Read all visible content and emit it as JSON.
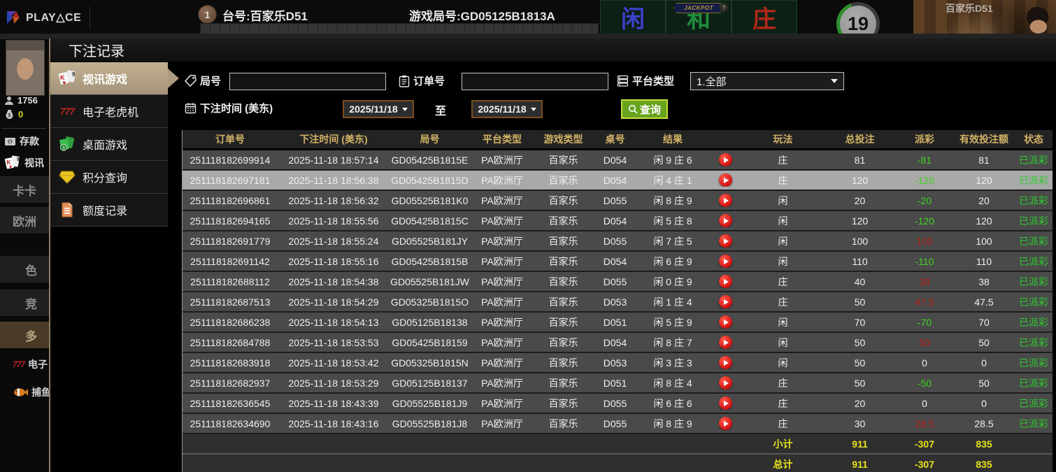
{
  "topbar": {
    "logo": "PLAY△CE",
    "badge": "1",
    "table_label": "台号:百家乐D51",
    "round_label": "游戏局号:GD05125B1813A",
    "jackpot_label": "JACKPOT",
    "jackpot_help": "?",
    "bet_zones": [
      {
        "label": "闲",
        "color": "#3b42c8"
      },
      {
        "label": "和",
        "color": "#1f8d3c"
      },
      {
        "label": "庄",
        "color": "#b02818"
      }
    ],
    "timer": "19",
    "video_label": "百家乐D51"
  },
  "left_rail": {
    "user_id": "1756",
    "balance": "0",
    "deposit_label": "存款",
    "video_label": "视讯",
    "menu": [
      {
        "label": "卡卡"
      },
      {
        "label": "欧洲"
      },
      {
        "label": "色"
      },
      {
        "label": "竞"
      },
      {
        "label": "多"
      },
      {
        "label": "电子"
      },
      {
        "label": "捕鱼"
      }
    ]
  },
  "modal": {
    "title": "下注记录",
    "sidebar": [
      {
        "label": "视讯游戏"
      },
      {
        "label": "电子老虎机"
      },
      {
        "label": "桌面游戏"
      },
      {
        "label": "积分查询"
      },
      {
        "label": "额度记录"
      }
    ],
    "filters": {
      "round_label": "局号",
      "round_value": "",
      "order_label": "订单号",
      "order_value": "",
      "platform_label": "平台类型",
      "platform_value": "1.全部",
      "time_label": "下注时间 (美东)",
      "date_from": "2025/11/18",
      "to_label": "至",
      "date_to": "2025/11/18",
      "search_label": "查询"
    },
    "table": {
      "headers": {
        "order": "订单号",
        "time": "下注时间 (美东)",
        "round": "局号",
        "platform": "平台类型",
        "game": "游戏类型",
        "table": "桌号",
        "result": "结果",
        "replay": "",
        "play": "玩法",
        "total_bet": "总投注",
        "payout": "派彩",
        "valid_bet": "有效投注额",
        "status": "状态"
      },
      "rows": [
        {
          "order": "251118182699914",
          "time": "2025-11-18 18:57:14",
          "round": "GD05425B1815E",
          "platform": "PA欧洲厅",
          "game": "百家乐",
          "table": "D054",
          "result": "闲 9 庄 6",
          "play": "庄",
          "total_bet": "81",
          "payout": "-81",
          "payout_color": "green",
          "valid_bet": "81",
          "status": "已派彩",
          "selected": false
        },
        {
          "order": "251118182697181",
          "time": "2025-11-18 18:56:38",
          "round": "GD05425B1815D",
          "platform": "PA欧洲厅",
          "game": "百家乐",
          "table": "D054",
          "result": "闲 4 庄 1",
          "play": "庄",
          "total_bet": "120",
          "payout": "-120",
          "payout_color": "green",
          "valid_bet": "120",
          "status": "已派彩",
          "selected": true
        },
        {
          "order": "251118182696861",
          "time": "2025-11-18 18:56:32",
          "round": "GD05525B181K0",
          "platform": "PA欧洲厅",
          "game": "百家乐",
          "table": "D055",
          "result": "闲 8 庄 9",
          "play": "闲",
          "total_bet": "20",
          "payout": "-20",
          "payout_color": "green",
          "valid_bet": "20",
          "status": "已派彩",
          "selected": false
        },
        {
          "order": "251118182694165",
          "time": "2025-11-18 18:55:56",
          "round": "GD05425B1815C",
          "platform": "PA欧洲厅",
          "game": "百家乐",
          "table": "D054",
          "result": "闲 5 庄 8",
          "play": "闲",
          "total_bet": "120",
          "payout": "-120",
          "payout_color": "green",
          "valid_bet": "120",
          "status": "已派彩",
          "selected": false
        },
        {
          "order": "251118182691779",
          "time": "2025-11-18 18:55:24",
          "round": "GD05525B181JY",
          "platform": "PA欧洲厅",
          "game": "百家乐",
          "table": "D055",
          "result": "闲 7 庄 5",
          "play": "闲",
          "total_bet": "100",
          "payout": "100",
          "payout_color": "red",
          "valid_bet": "100",
          "status": "已派彩",
          "selected": false
        },
        {
          "order": "251118182691142",
          "time": "2025-11-18 18:55:16",
          "round": "GD05425B1815B",
          "platform": "PA欧洲厅",
          "game": "百家乐",
          "table": "D054",
          "result": "闲 6 庄 9",
          "play": "闲",
          "total_bet": "110",
          "payout": "-110",
          "payout_color": "green",
          "valid_bet": "110",
          "status": "已派彩",
          "selected": false
        },
        {
          "order": "251118182688112",
          "time": "2025-11-18 18:54:38",
          "round": "GD05525B181JW",
          "platform": "PA欧洲厅",
          "game": "百家乐",
          "table": "D055",
          "result": "闲 0 庄 9",
          "play": "庄",
          "total_bet": "40",
          "payout": "38",
          "payout_color": "red",
          "valid_bet": "38",
          "status": "已派彩",
          "selected": false
        },
        {
          "order": "251118182687513",
          "time": "2025-11-18 18:54:29",
          "round": "GD05325B1815O",
          "platform": "PA欧洲厅",
          "game": "百家乐",
          "table": "D053",
          "result": "闲 1 庄 4",
          "play": "庄",
          "total_bet": "50",
          "payout": "47.5",
          "payout_color": "red",
          "valid_bet": "47.5",
          "status": "已派彩",
          "selected": false
        },
        {
          "order": "251118182686238",
          "time": "2025-11-18 18:54:13",
          "round": "GD05125B18138",
          "platform": "PA欧洲厅",
          "game": "百家乐",
          "table": "D051",
          "result": "闲 5 庄 9",
          "play": "闲",
          "total_bet": "70",
          "payout": "-70",
          "payout_color": "green",
          "valid_bet": "70",
          "status": "已派彩",
          "selected": false
        },
        {
          "order": "251118182684788",
          "time": "2025-11-18 18:53:53",
          "round": "GD05425B18159",
          "platform": "PA欧洲厅",
          "game": "百家乐",
          "table": "D054",
          "result": "闲 8 庄 7",
          "play": "闲",
          "total_bet": "50",
          "payout": "50",
          "payout_color": "red",
          "valid_bet": "50",
          "status": "已派彩",
          "selected": false
        },
        {
          "order": "251118182683918",
          "time": "2025-11-18 18:53:42",
          "round": "GD05325B1815N",
          "platform": "PA欧洲厅",
          "game": "百家乐",
          "table": "D053",
          "result": "闲 3 庄 3",
          "play": "闲",
          "total_bet": "50",
          "payout": "0",
          "payout_color": "white",
          "valid_bet": "0",
          "status": "已派彩",
          "selected": false
        },
        {
          "order": "251118182682937",
          "time": "2025-11-18 18:53:29",
          "round": "GD05125B18137",
          "platform": "PA欧洲厅",
          "game": "百家乐",
          "table": "D051",
          "result": "闲 8 庄 4",
          "play": "庄",
          "total_bet": "50",
          "payout": "-50",
          "payout_color": "green",
          "valid_bet": "50",
          "status": "已派彩",
          "selected": false
        },
        {
          "order": "251118182636545",
          "time": "2025-11-18 18:43:39",
          "round": "GD05525B181J9",
          "platform": "PA欧洲厅",
          "game": "百家乐",
          "table": "D055",
          "result": "闲 6 庄 6",
          "play": "庄",
          "total_bet": "20",
          "payout": "0",
          "payout_color": "white",
          "valid_bet": "0",
          "status": "已派彩",
          "selected": false
        },
        {
          "order": "251118182634690",
          "time": "2025-11-18 18:43:16",
          "round": "GD05525B181J8",
          "platform": "PA欧洲厅",
          "game": "百家乐",
          "table": "D055",
          "result": "闲 8 庄 9",
          "play": "庄",
          "total_bet": "30",
          "payout": "28.5",
          "payout_color": "red",
          "valid_bet": "28.5",
          "status": "已派彩",
          "selected": false
        }
      ],
      "subtotal": {
        "label": "小计",
        "total_bet": "911",
        "payout": "-307",
        "valid_bet": "835"
      },
      "total": {
        "label": "总计",
        "total_bet": "911",
        "payout": "-307",
        "valid_bet": "835"
      }
    }
  },
  "colors": {
    "active_tab": "#b3a183",
    "header_gold": "#d2b266",
    "win_red": "#b51d15",
    "loss_green": "#3fd41f",
    "total_yellow": "#e8e41c",
    "status_green": "#2ecc2e",
    "search_green": "#67a31d",
    "date_border": "#7d4e1e"
  }
}
